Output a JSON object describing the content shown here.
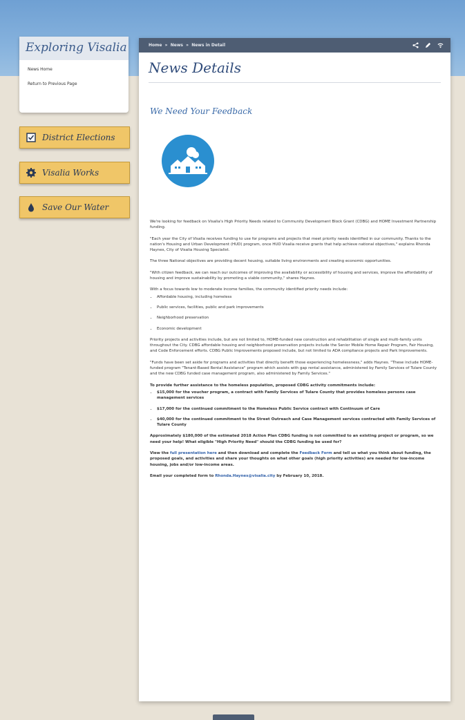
{
  "sidebar": {
    "title": "Exploring Visalia",
    "links": [
      "News Home",
      "Return to Previous Page"
    ],
    "buttons": [
      {
        "label": "District Elections",
        "icon": "checkbox-icon"
      },
      {
        "label": "Visalia Works",
        "icon": "gear-icon"
      },
      {
        "label": "Save Our Water",
        "icon": "water-drop-icon"
      }
    ]
  },
  "breadcrumb": {
    "items": [
      "Home",
      "News",
      "News in Detail"
    ],
    "separator": "»"
  },
  "page": {
    "title": "News Details",
    "subtitle": "We Need Your Feedback"
  },
  "article": {
    "p1": "We're looking for feedback on Visalia's High Priority Needs related to Community Development Block Grant (CDBG) and HOME Investment Partnership funding.",
    "p2": "\"Each year the City of Visalia receives funding to use for programs and projects that meet priority needs identified in our community. Thanks to the nation's Housing and Urban Development (HUD) program, once HUD Visalia receive grants that help achieve national objectives,\" explains Rhonda Haynes, City of Visalia Housing Specialist.",
    "p3": "The three National objectives are providing decent housing, suitable living environments and creating economic opportunities.",
    "p4": "\"With citizen feedback, we can reach our outcomes of improving the availability or accessibility of housing and services, improve the affordability of housing and improve sustainability by promoting a viable community,\" shares Haynes.",
    "p5": "With a focus towards low to moderate income families, the community identified priority needs include:",
    "needs": [
      "Affordable housing, including homeless",
      "Public services, facilities, public and park improvements",
      "Neighborhood preservation",
      "Economic development"
    ],
    "p6": "Priority projects and activities include, but are not limited to, HOME-funded new construction and rehabilitation of single and multi-family units throughout the City. CDBG affordable housing and neighborhood preservation projects include the Senior Mobile Home Repair Program, Fair Housing, and Code Enforcement efforts. CDBG Public Improvements proposed include, but not limited to ADA compliance projects and Park Improvements.",
    "p7": "\"Funds have been set aside for programs and activities that directly benefit those experiencing homelessness,\" adds Haynes. \"These include HOME-funded program \"Tenant-Based Rental Assistance\" program which assists with gap rental assistance, administered by Family Services of Tulare County and the new CDBG funded case management program, also administered by Family Services.\"",
    "p8": "To provide further assistance to the homeless population, proposed CDBG activity commitments include:",
    "commitments": [
      "$15,000 for the voucher program, a contract with Family Services of Tulare County that provides homeless persons case management services",
      "$17,000 for the continued commitment to the Homeless Public Service contract with Continuum of Care",
      "$40,000 for the continued commitment to the Street Outreach and Case Management services contracted with Family Services of Tulare County"
    ],
    "p9": "Approximately $180,000 of the estimated 2018 Action Plan CDBG funding is not committed to an existing project or program, so we need your help! What eligible \"High Priority Need\" should the CDBG funding be used for?",
    "p10_pre": "View the ",
    "p10_link1": "full presentation here",
    "p10_mid": " and then download and complete the ",
    "p10_link2": "Feedback Form",
    "p10_post": " and tell us what you think about funding, the proposed goals, and activities and share your thoughts on what other goals (high priority activities) are needed for low-income housing, jobs and/or low-income areas.",
    "p11_pre": "Email your completed form to ",
    "p11_link": "Rhonda.Haynes@visalia.city",
    "p11_post": " by February 10, 2018."
  },
  "colors": {
    "sky": "#6fa0d3",
    "topbar": "#4e5d73",
    "title": "#2f4b7a",
    "button": "#f0c668",
    "logo": "#2a8fd0"
  }
}
